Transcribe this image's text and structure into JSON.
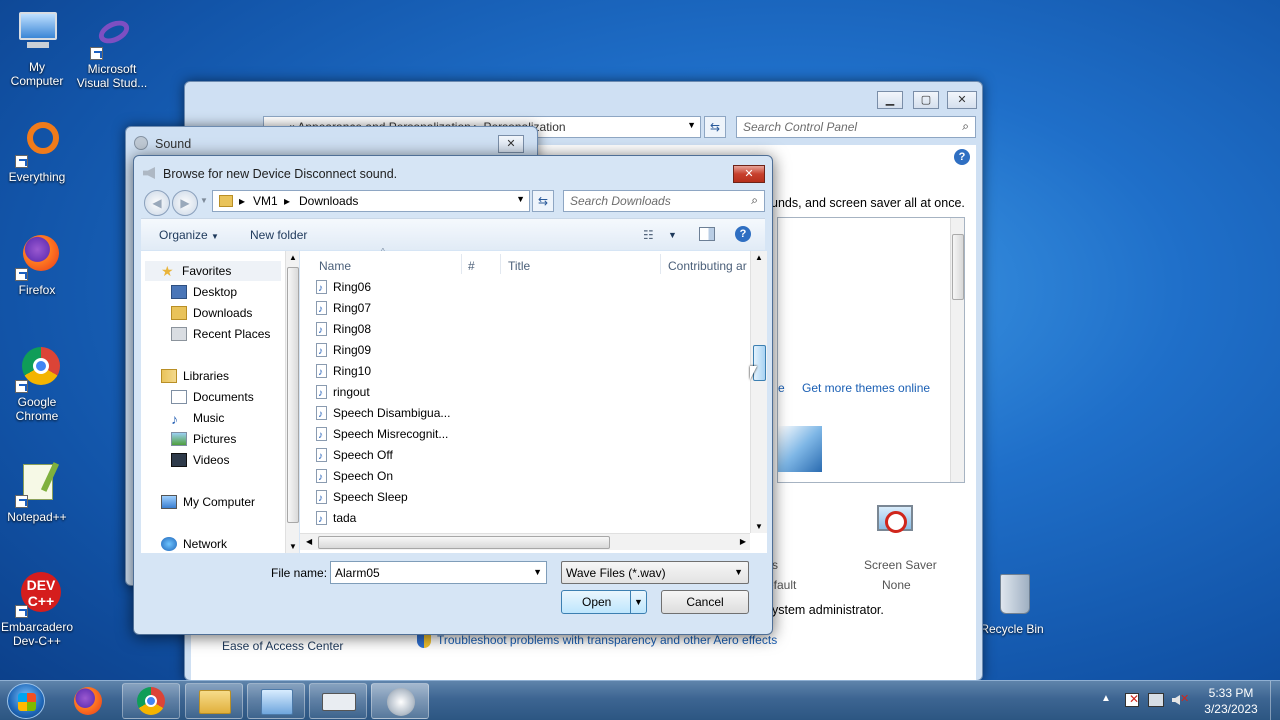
{
  "desktop": {
    "icons": [
      {
        "label": "My\nComputer"
      },
      {
        "label": "Microsoft\nVisual Stud..."
      },
      {
        "label": "Everything"
      },
      {
        "label": "Firefox"
      },
      {
        "label": "Google\nChrome"
      },
      {
        "label": "Notepad++"
      },
      {
        "label": "Embarcadero\nDev-C++"
      },
      {
        "label": "Recycle Bin"
      }
    ]
  },
  "control_panel": {
    "breadcrumb": "«  Appearance and Personalization  ▸  Personalization",
    "search_placeholder": "Search Control Panel",
    "intro_text": "unds, and screen saver all at once.",
    "link_partial": "e",
    "get_more_themes": "Get more themes online",
    "default_partial": "efault",
    "s_partial": "s",
    "screen_saver_label": "Screen Saver",
    "screen_saver_value": "None",
    "admin_text": "ystem administrator.",
    "ease_of_access": "Ease of Access Center",
    "troubleshoot": "Troubleshoot problems with transparency and other Aero effects"
  },
  "sound_dialog": {
    "title": "Sound"
  },
  "browse_dialog": {
    "title": "Browse for new Device Disconnect sound.",
    "path": [
      "VM1",
      "Downloads"
    ],
    "search_placeholder": "Search Downloads",
    "toolbar": {
      "organize": "Organize",
      "new_folder": "New folder"
    },
    "nav": {
      "favorites": "Favorites",
      "favorites_items": [
        "Desktop",
        "Downloads",
        "Recent Places"
      ],
      "libraries": "Libraries",
      "libraries_items": [
        "Documents",
        "Music",
        "Pictures",
        "Videos"
      ],
      "my_computer": "My Computer",
      "network": "Network"
    },
    "columns": [
      "Name",
      "#",
      "Title",
      "Contributing ar"
    ],
    "files": [
      "Ring06",
      "Ring07",
      "Ring08",
      "Ring09",
      "Ring10",
      "ringout",
      "Speech Disambigua...",
      "Speech Misrecognit...",
      "Speech Off",
      "Speech On",
      "Speech Sleep",
      "tada"
    ],
    "file_name_label": "File name:",
    "file_name_value": "Alarm05",
    "file_type": "Wave Files (*.wav)",
    "open_label": "Open",
    "cancel_label": "Cancel"
  },
  "taskbar": {
    "time": "5:33 PM",
    "date": "3/23/2023"
  }
}
